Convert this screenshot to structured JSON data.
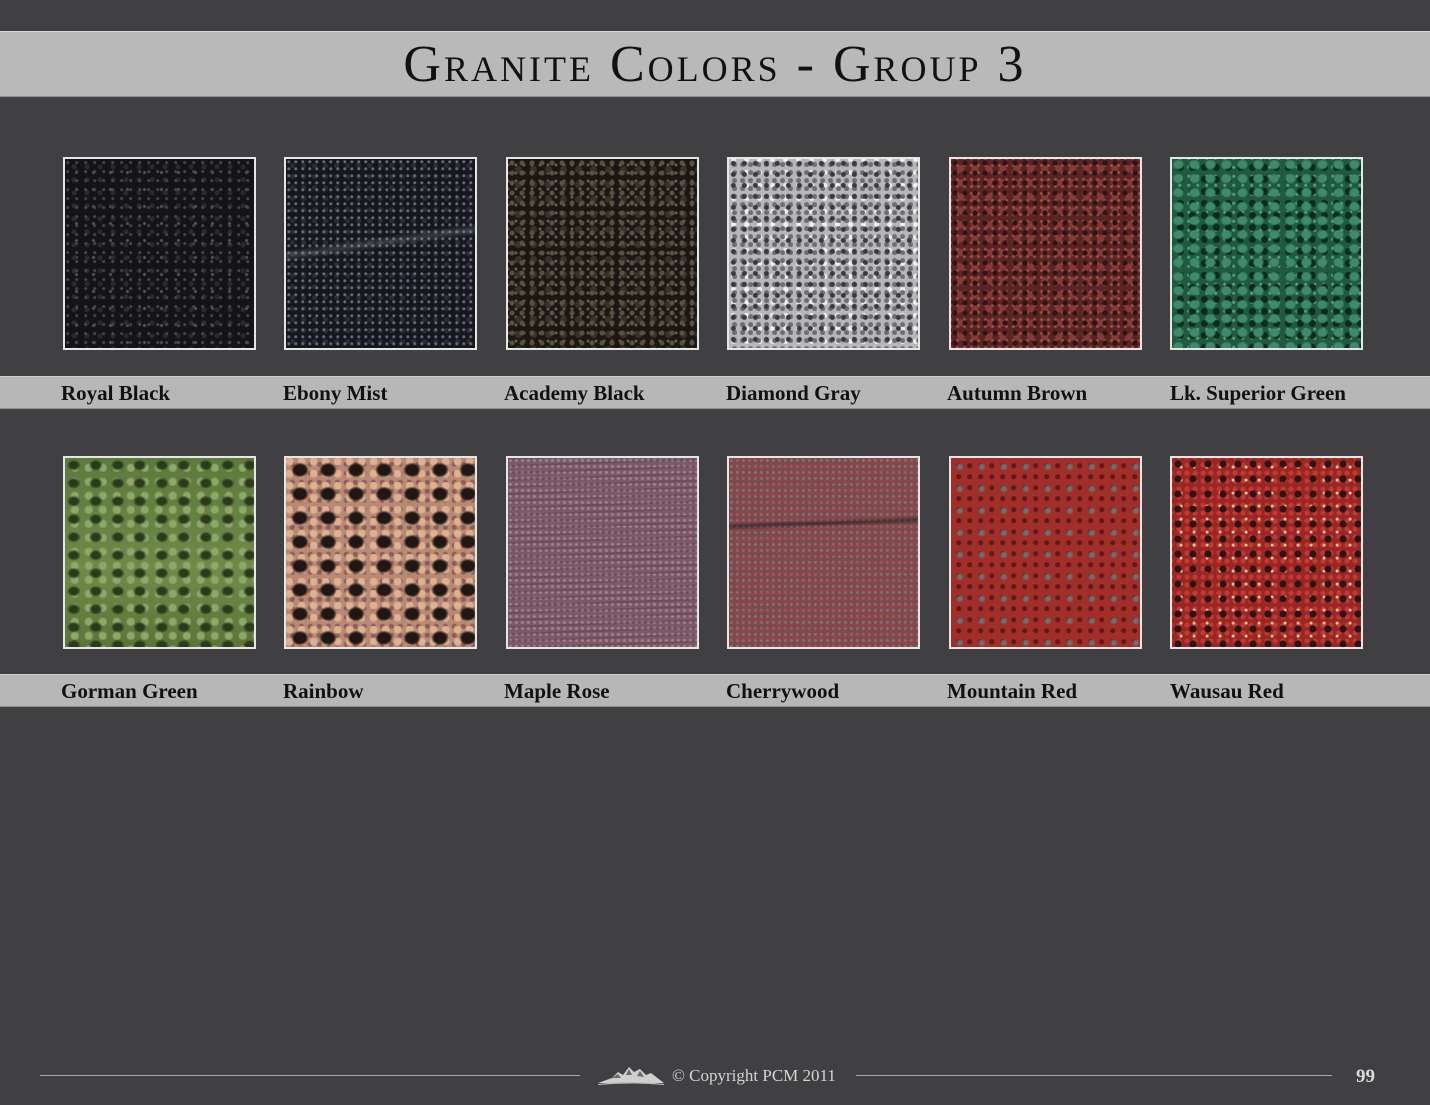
{
  "title": "Granite Colors - Group 3",
  "rows": [
    [
      {
        "name": "Royal Black"
      },
      {
        "name": "Ebony Mist"
      },
      {
        "name": "Academy Black"
      },
      {
        "name": "Diamond Gray"
      },
      {
        "name": "Autumn Brown"
      },
      {
        "name": "Lk. Superior Green"
      }
    ],
    [
      {
        "name": "Gorman Green"
      },
      {
        "name": "Rainbow"
      },
      {
        "name": "Maple Rose"
      },
      {
        "name": "Cherrywood"
      },
      {
        "name": "Mountain Red"
      },
      {
        "name": "Wausau Red"
      }
    ]
  ],
  "footer": {
    "copyright": "© Copyright PCM 2011",
    "page_number": "99"
  },
  "colors": {
    "background": "#403f42",
    "band": "#b9b9b9",
    "text": "#111111"
  }
}
